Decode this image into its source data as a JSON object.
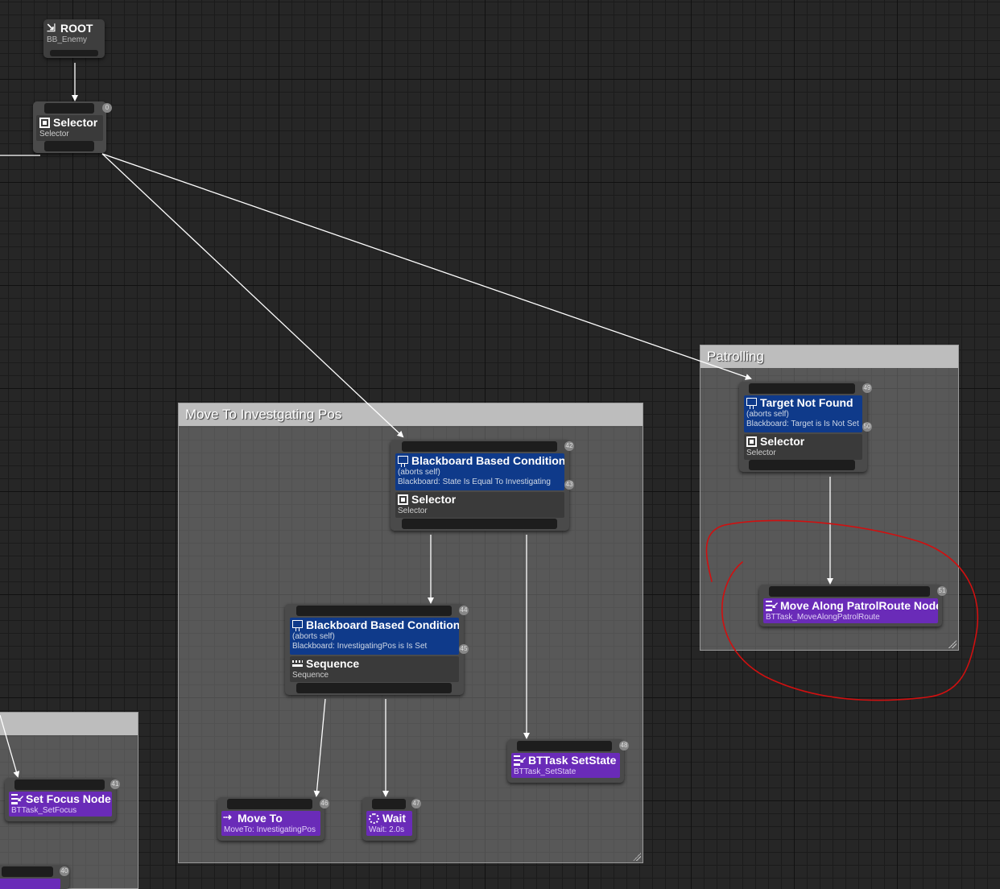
{
  "comments": {
    "move_to": {
      "title": "Move To Investgating Pos"
    },
    "patrolling": {
      "title": "Patrolling"
    },
    "left": {
      "title": ""
    }
  },
  "nodes": {
    "root": {
      "title": "ROOT",
      "sub": "BB_Enemy"
    },
    "selector_main": {
      "index": "0",
      "title": "Selector",
      "sub": "Selector"
    },
    "bb_cond_investigating": {
      "index": "42",
      "title": "Blackboard Based Condition",
      "aborts": "(aborts self)",
      "desc": "Blackboard: State Is Equal To Investigating",
      "dec_index": "43",
      "child_title": "Selector",
      "child_sub": "Selector"
    },
    "bb_cond_pos": {
      "index": "44",
      "title": "Blackboard Based Condition",
      "aborts": "(aborts self)",
      "desc": "Blackboard: InvestigatingPos is Is Set",
      "dec_index": "45",
      "child_title": "Sequence",
      "child_sub": "Sequence"
    },
    "target_not_found": {
      "index": "49",
      "title": "Target Not Found",
      "aborts": "(aborts self)",
      "desc": "Blackboard: Target is Is Not Set",
      "dec_index": "50",
      "child_title": "Selector",
      "child_sub": "Selector"
    },
    "move_patrol": {
      "index": "51",
      "title": "Move Along PatrolRoute Node",
      "sub": "BTTask_MoveAlongPatrolRoute"
    },
    "set_state": {
      "index": "48",
      "title": "BTTask SetState",
      "sub": "BTTask_SetState"
    },
    "move_to": {
      "index": "46",
      "title": "Move To",
      "sub": "MoveTo: InvestigatingPos"
    },
    "wait": {
      "index": "47",
      "title": "Wait",
      "sub": "Wait: 2.0s"
    },
    "set_focus": {
      "index": "41",
      "title": "Set Focus Node",
      "sub": "BTTask_SetFocus"
    },
    "partial_bottom": {
      "index": "40"
    }
  },
  "colors": {
    "decorator": "#0f3a8a",
    "task": "#6a2bb8",
    "composite": "#3a3a3a",
    "annotation": "#d01010"
  }
}
